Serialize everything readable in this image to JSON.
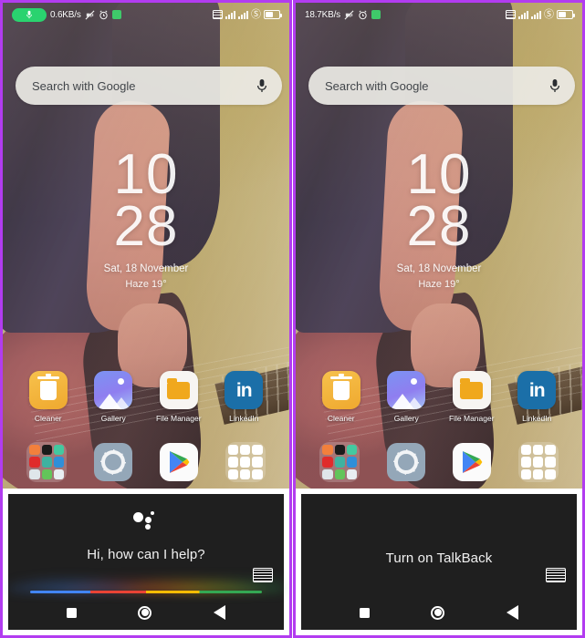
{
  "panels": [
    {
      "id": "left",
      "status": {
        "network_speed": "0.6KB/s",
        "mic_icon": "microphone-icon",
        "mute_icon": "vibrate-off-icon",
        "alarm_icon": "alarm-clock-icon",
        "badge_icon": "green-badge-icon",
        "sim_icon": "sim-card-icon",
        "signal1_icon": "signal-4g-icon",
        "signal2_icon": "signal-bars-icon",
        "dnd_icon": "do-not-disturb-icon",
        "battery_icon": "battery-icon"
      },
      "search": {
        "placeholder": "Search with Google",
        "mic_icon": "microphone-icon"
      },
      "clock": {
        "hours": "10",
        "minutes": "28",
        "date": "Sat, 18 November",
        "weather": "Haze  19°"
      },
      "apps": [
        {
          "label": "Cleaner",
          "icon": "cleaner-icon"
        },
        {
          "label": "Gallery",
          "icon": "gallery-icon"
        },
        {
          "label": "File Manager",
          "icon": "file-manager-icon"
        },
        {
          "label": "LinkedIn",
          "icon": "linkedin-icon"
        }
      ],
      "dock": [
        {
          "name": "apps-folder",
          "icon": "folder-icon"
        },
        {
          "name": "settings",
          "icon": "gear-icon"
        },
        {
          "name": "play-store",
          "icon": "play-store-icon"
        },
        {
          "name": "google-folder",
          "icon": "google-folder-icon"
        }
      ],
      "assistant": {
        "message": "Hi, how can I help?",
        "logo_icon": "google-assistant-dots-icon",
        "keyboard_icon": "keyboard-icon",
        "show_logo": true,
        "show_glow": true,
        "nav": {
          "recents_icon": "recents-square-icon",
          "home_icon": "home-circle-icon",
          "back_icon": "back-triangle-icon"
        }
      }
    },
    {
      "id": "right",
      "status": {
        "network_speed": "18.7KB/s",
        "mic_icon": "microphone-icon",
        "mute_icon": "vibrate-off-icon",
        "alarm_icon": "alarm-clock-icon",
        "badge_icon": "green-badge-icon",
        "sim_icon": "sim-card-icon",
        "signal1_icon": "signal-4g-icon",
        "signal2_icon": "signal-bars-icon",
        "dnd_icon": "do-not-disturb-icon",
        "battery_icon": "battery-icon"
      },
      "search": {
        "placeholder": "Search with Google",
        "mic_icon": "microphone-icon"
      },
      "clock": {
        "hours": "10",
        "minutes": "28",
        "date": "Sat, 18 November",
        "weather": "Haze  19°"
      },
      "apps": [
        {
          "label": "Cleaner",
          "icon": "cleaner-icon"
        },
        {
          "label": "Gallery",
          "icon": "gallery-icon"
        },
        {
          "label": "File Manager",
          "icon": "file-manager-icon"
        },
        {
          "label": "LinkedIn",
          "icon": "linkedin-icon"
        }
      ],
      "dock": [
        {
          "name": "apps-folder",
          "icon": "folder-icon"
        },
        {
          "name": "settings",
          "icon": "gear-icon"
        },
        {
          "name": "play-store",
          "icon": "play-store-icon"
        },
        {
          "name": "google-folder",
          "icon": "google-folder-icon"
        }
      ],
      "assistant": {
        "message": "Turn on TalkBack",
        "logo_icon": "google-assistant-dots-icon",
        "keyboard_icon": "keyboard-icon",
        "show_logo": false,
        "show_glow": false,
        "nav": {
          "recents_icon": "recents-square-icon",
          "home_icon": "home-circle-icon",
          "back_icon": "back-triangle-icon"
        }
      }
    }
  ],
  "colors": {
    "highlight_border": "#b23cf0",
    "assistant_bg": "#1f1f1f",
    "mic_pill_green": "#2ad36f",
    "google_blue": "#4285f4",
    "google_red": "#ea4335",
    "google_yellow": "#fbbc04",
    "google_green": "#34a853"
  },
  "folder_tiles": {
    "apps_folder": [
      "#f2803c",
      "#1b1b1b",
      "#43c9a0",
      "#e02b2b",
      "#3fb2a0",
      "#2f8fd8",
      "#dfe6ea",
      "#63c45a",
      "#e8eef2"
    ],
    "google_folder": [
      "#ffffff",
      "#ffffff",
      "#ffffff",
      "#ffffff",
      "#ffffff",
      "#ffffff",
      "#ffffff",
      "#ffffff",
      "#ffffff"
    ]
  }
}
